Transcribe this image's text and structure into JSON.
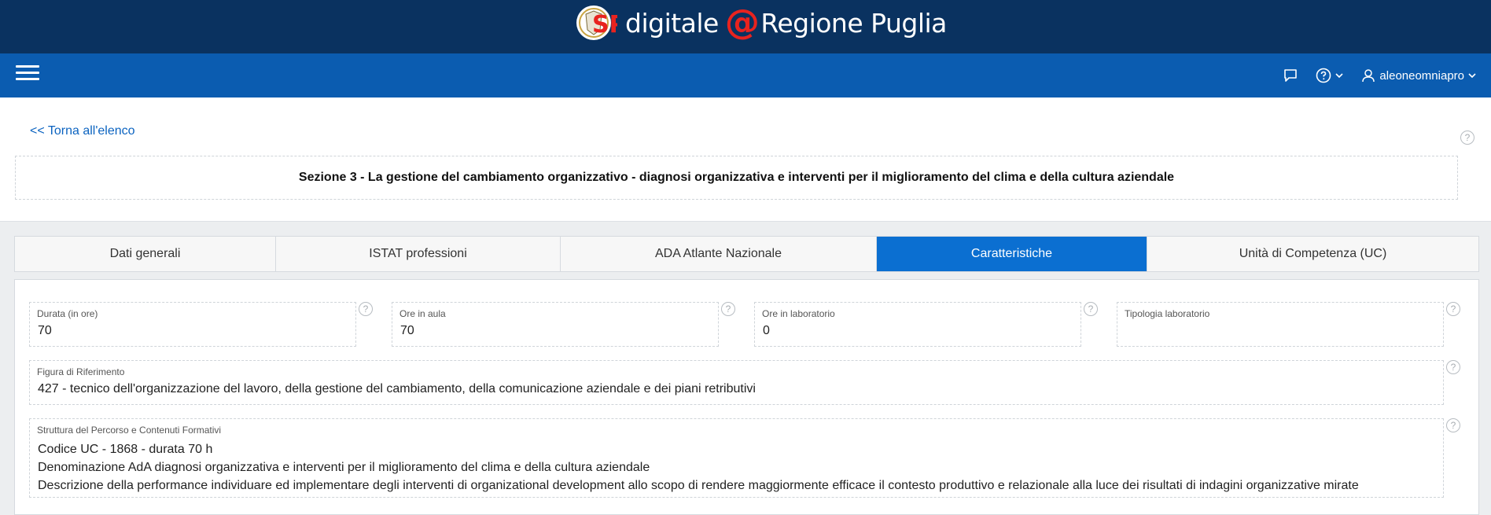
{
  "brand": {
    "logo_text": "SP",
    "word1": "digitale",
    "at": "@",
    "word2": "Regione Puglia"
  },
  "navbar": {
    "user_name": "aleoneomniapro"
  },
  "back_link": "<< Torna all'elenco",
  "section_title": "Sezione 3 - La gestione del cambiamento organizzativo - diagnosi organizzativa e interventi per il miglioramento del clima e della cultura aziendale",
  "tabs": [
    {
      "label": "Dati generali"
    },
    {
      "label": "ISTAT professioni"
    },
    {
      "label": "ADA Atlante Nazionale"
    },
    {
      "label": "Caratteristiche"
    },
    {
      "label": "Unità di Competenza (UC)"
    }
  ],
  "active_tab": "Caratteristiche",
  "fields": {
    "durata": {
      "label": "Durata (in ore)",
      "value": "70"
    },
    "ore_aula": {
      "label": "Ore in aula",
      "value": "70"
    },
    "ore_laboratorio": {
      "label": "Ore in laboratorio",
      "value": "0"
    },
    "tipologia_laboratorio": {
      "label": "Tipologia laboratorio",
      "value": ""
    },
    "figura": {
      "label": "Figura di Riferimento",
      "value": "427 - tecnico dell'organizzazione del lavoro, della gestione del cambiamento, della comunicazione aziendale e dei piani retributivi"
    },
    "struttura": {
      "label": "Struttura del Percorso e Contenuti Formativi",
      "lines": [
        "Codice UC - 1868 - durata 70 h",
        "Denominazione AdA diagnosi organizzativa e interventi per il miglioramento del clima e della cultura aziendale",
        "Descrizione della performance individuare ed implementare degli interventi di organizational development allo scopo di rendere maggiormente efficace il contesto produttivo e relazionale alla luce dei risultati di indagini organizzative mirate"
      ]
    }
  },
  "help_glyph": "?",
  "colors": {
    "brand_bar": "#0a3260",
    "nav_bar": "#0b5cb0",
    "active_tab": "#0b6fd1",
    "link": "#0b63c0",
    "at_sign": "#e8231f"
  }
}
